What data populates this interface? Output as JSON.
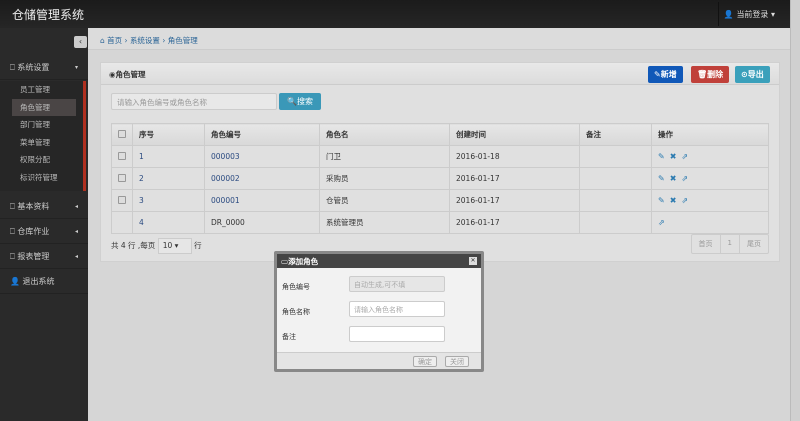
{
  "app": {
    "title": "仓储管理系统",
    "user": "当前登录"
  },
  "sidebar": {
    "collapse": "‹",
    "groups": [
      {
        "label": "系统设置",
        "caret": "▾"
      },
      {
        "label": "基本资料",
        "caret": "◂"
      },
      {
        "label": "仓库作业",
        "caret": "◂"
      },
      {
        "label": "报表管理",
        "caret": "◂"
      },
      {
        "label": "退出系统"
      }
    ],
    "sub": [
      "员工管理",
      "角色管理",
      "部门管理",
      "菜单管理",
      "权限分配",
      "标识符管理"
    ]
  },
  "breadcrumb": [
    "首页",
    "系统设置",
    "角色管理"
  ],
  "panel": {
    "title": "角色管理",
    "add": "新增",
    "delete": "删除",
    "export": "导出",
    "search_placeholder": "请输入角色编号或角色名称",
    "search": "搜索"
  },
  "table": {
    "headers": [
      "序号",
      "角色编号",
      "角色名",
      "创建时间",
      "备注",
      "操作"
    ],
    "rows": [
      [
        "1",
        "000003",
        "门卫",
        "2016-01-18",
        ""
      ],
      [
        "2",
        "000002",
        "采购员",
        "2016-01-17",
        ""
      ],
      [
        "3",
        "000001",
        "仓管员",
        "2016-01-17",
        ""
      ],
      [
        "4",
        "DR_0000",
        "系统管理员",
        "2016-01-17",
        ""
      ]
    ]
  },
  "footer": {
    "prefix": "共 4 行 ,每页",
    "page_size": "10",
    "suffix": "行",
    "first": "首页",
    "page": "1",
    "last": "尾页"
  },
  "modal": {
    "title": "添加角色",
    "code_label": "角色编号",
    "code_placeholder": "自动生成,可不填",
    "name_label": "角色名称",
    "name_placeholder": "请输入角色名称",
    "remark_label": "备注",
    "ok": "确定",
    "close": "关闭"
  }
}
